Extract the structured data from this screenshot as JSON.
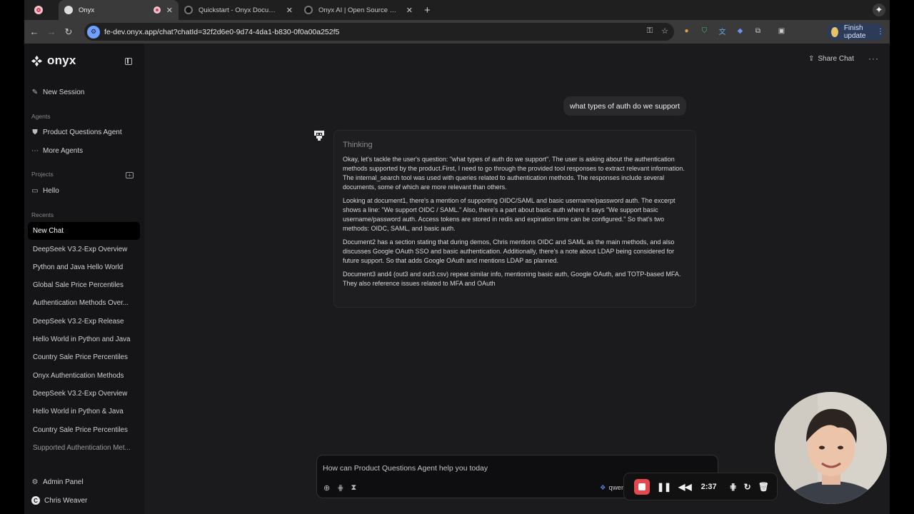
{
  "browser": {
    "tabs": [
      {
        "title": "Onyx",
        "active": true
      },
      {
        "title": "Quickstart - Onyx Documentati",
        "active": false
      },
      {
        "title": "Onyx AI | Open Source Enterp",
        "active": false
      }
    ],
    "url": "fe-dev.onyx.app/chat?chatId=32f2d6e0-9d74-4da1-b830-0f0a00a252f5",
    "finish_update": "Finish update"
  },
  "sidebar": {
    "brand": "onyx",
    "new_session": "New Session",
    "agents_heading": "Agents",
    "agents": [
      "Product Questions Agent",
      "More Agents"
    ],
    "projects_heading": "Projects",
    "projects": [
      "Hello"
    ],
    "recents_heading": "Recents",
    "recents": [
      "New Chat",
      "DeepSeek V3.2-Exp Overview",
      "Python and Java Hello World",
      "Global Sale Price Percentiles",
      "Authentication Methods Over...",
      "DeepSeek V3.2-Exp Release",
      "Hello World in Python and Java",
      "Country Sale Price Percentiles",
      "Onyx Authentication Methods",
      "DeepSeek V3.2-Exp Overview",
      "Hello World in Python & Java",
      "Country Sale Price Percentiles",
      "Supported Authentication Met..."
    ],
    "admin_panel": "Admin Panel",
    "user_name": "Chris Weaver",
    "user_initial": "C"
  },
  "header": {
    "share_chat": "Share Chat"
  },
  "chat": {
    "user_message": "what types of auth do we support",
    "thinking_title": "Thinking",
    "thinking_paragraphs": [
      "Okay, let's tackle the user's question: \"what types of auth do we support\". The user is asking about the authentication methods supported by the product.First, I need to go through the provided tool responses to extract relevant information. The internal_search tool was used with queries related to authentication methods. The responses include several documents, some of which are more relevant than others.",
      "Looking at document1, there's a mention of supporting OIDC/SAML and basic username/password auth. The excerpt shows a line: \"We support OIDC / SAML.\" Also, there's a part about basic auth where it says \"We support basic username/password auth. Access tokens are stored in redis and expiration time can be configured.\" So that's two methods: OIDC, SAML, and basic auth.",
      "Document2 has a section stating that during demos, Chris mentions OIDC and SAML as the main methods, and also discusses Google OAuth SSO and basic authentication. Additionally, there's a note about LDAP being considered for future support. So that adds Google OAuth and mentions LDAP as planned.",
      "Document3 and4 (out3 and out3.csv) repeat similar info, mentioning basic auth, Google OAuth, and TOTP-based MFA. They also reference issues related to MFA and OAuth"
    ]
  },
  "composer": {
    "placeholder": "How can Product Questions Agent help you today",
    "model_label": "qwen"
  },
  "recorder": {
    "time": "2:37"
  },
  "colors": {
    "background": "#1b1b1d",
    "sidebar": "#151517",
    "accent_record": "#e5484d",
    "finish_update_bg": "#2b3b58"
  },
  "icons": {
    "new_session": "edit-icon",
    "agent": "onyx-agent-icon",
    "more_agents": "dots-icon",
    "project": "folder-icon",
    "admin": "gear-icon",
    "share": "share-icon"
  }
}
